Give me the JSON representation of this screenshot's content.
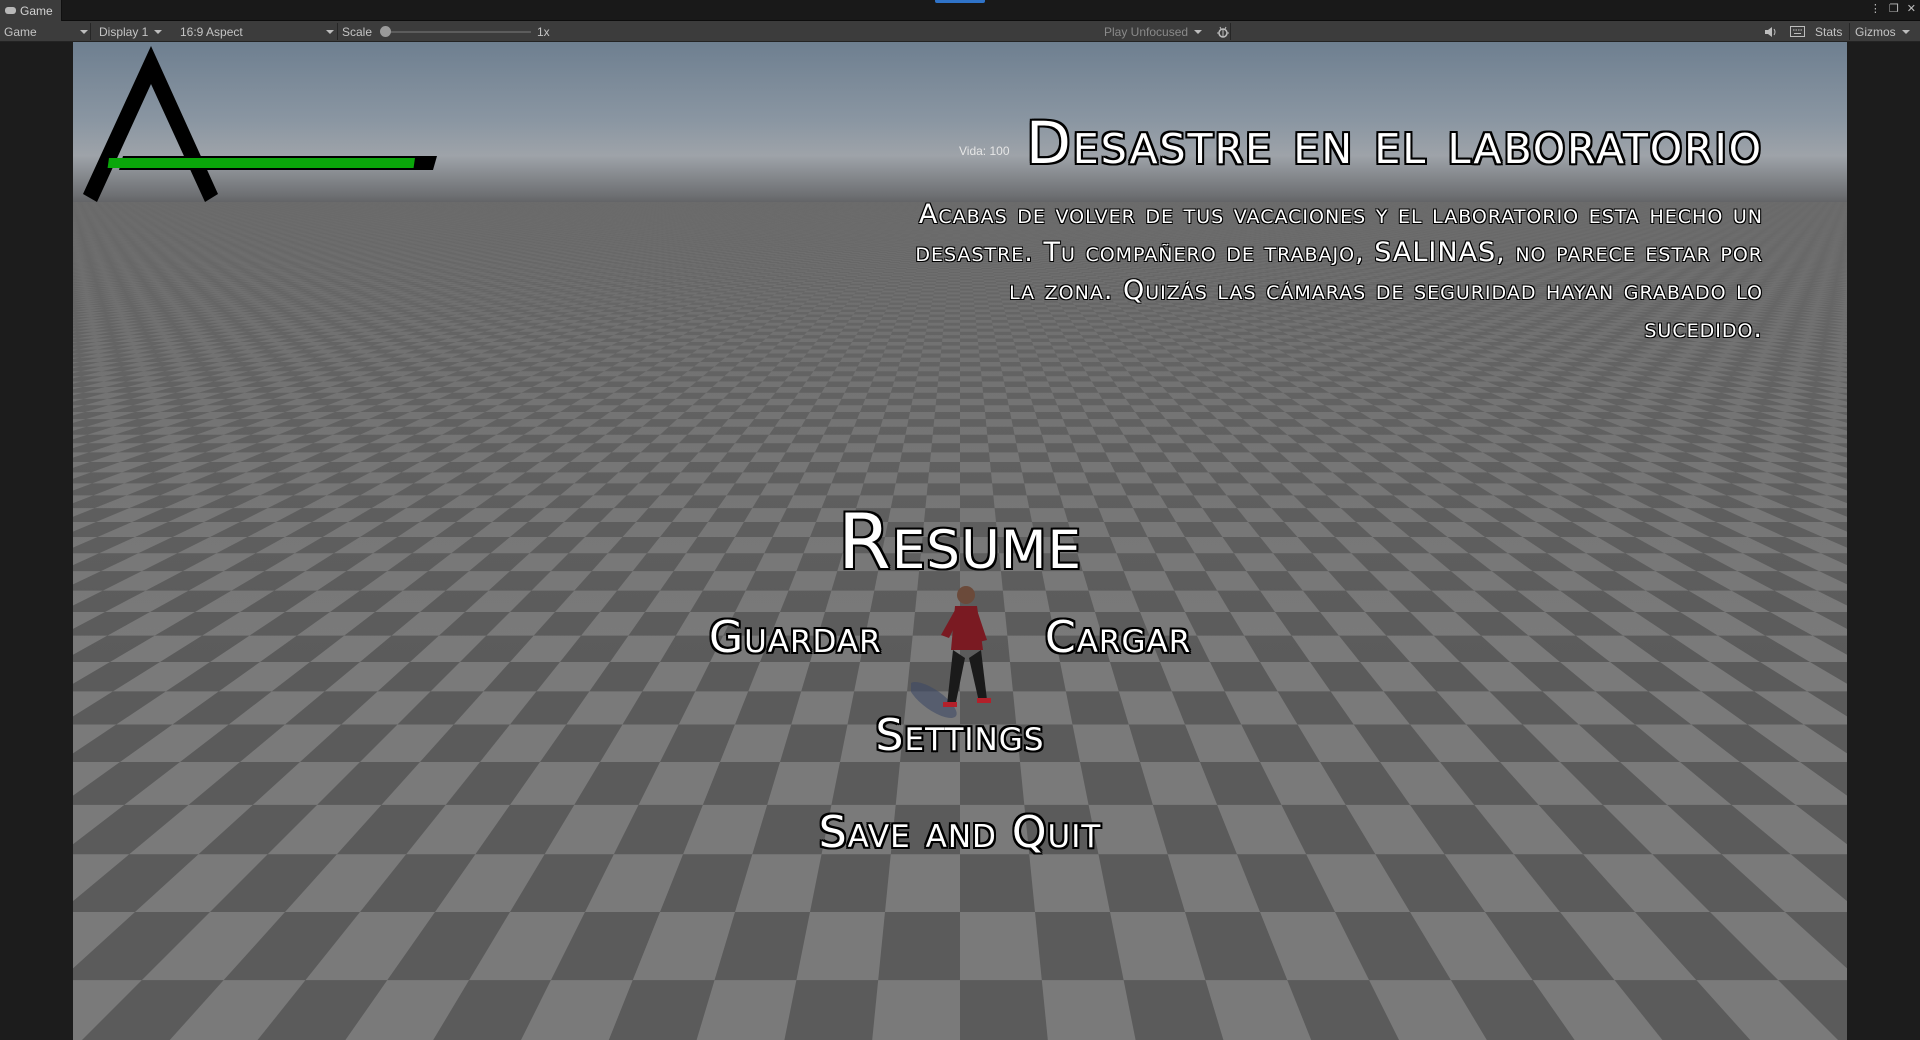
{
  "tabs": {
    "game_tab": "Game"
  },
  "toolbar": {
    "mode": "Game",
    "display": "Display 1",
    "aspect": "16:9 Aspect",
    "scale_label": "Scale",
    "scale_value": "1x",
    "scale_level": 0.0,
    "play_mode": "Play Unfocused",
    "stats": "Stats",
    "gizmos": "Gizmos"
  },
  "hud": {
    "vida_label": "Vida: 100",
    "health_fraction": 1.0,
    "health_color": "#0aa60a"
  },
  "story": {
    "title": "Desastre en el laboratorio",
    "description": "Acabas de volver de tus vacaciones y el laboratorio esta hecho un desastre. Tu compañero de trabajo, SALINAS, no parece estar por la zona. Quizás las cámaras de seguridad hayan grabado lo sucedido."
  },
  "menu": {
    "resume": "Resume",
    "guardar": "Guardar",
    "cargar": "Cargar",
    "settings": "Settings",
    "save_and_quit": "Save and Quit"
  },
  "colors": {
    "editor_bg": "#3c3c3c",
    "checker_light": "#7a7a7a",
    "checker_dark": "#5b5b5b",
    "accent_blue": "#2f73c8"
  }
}
